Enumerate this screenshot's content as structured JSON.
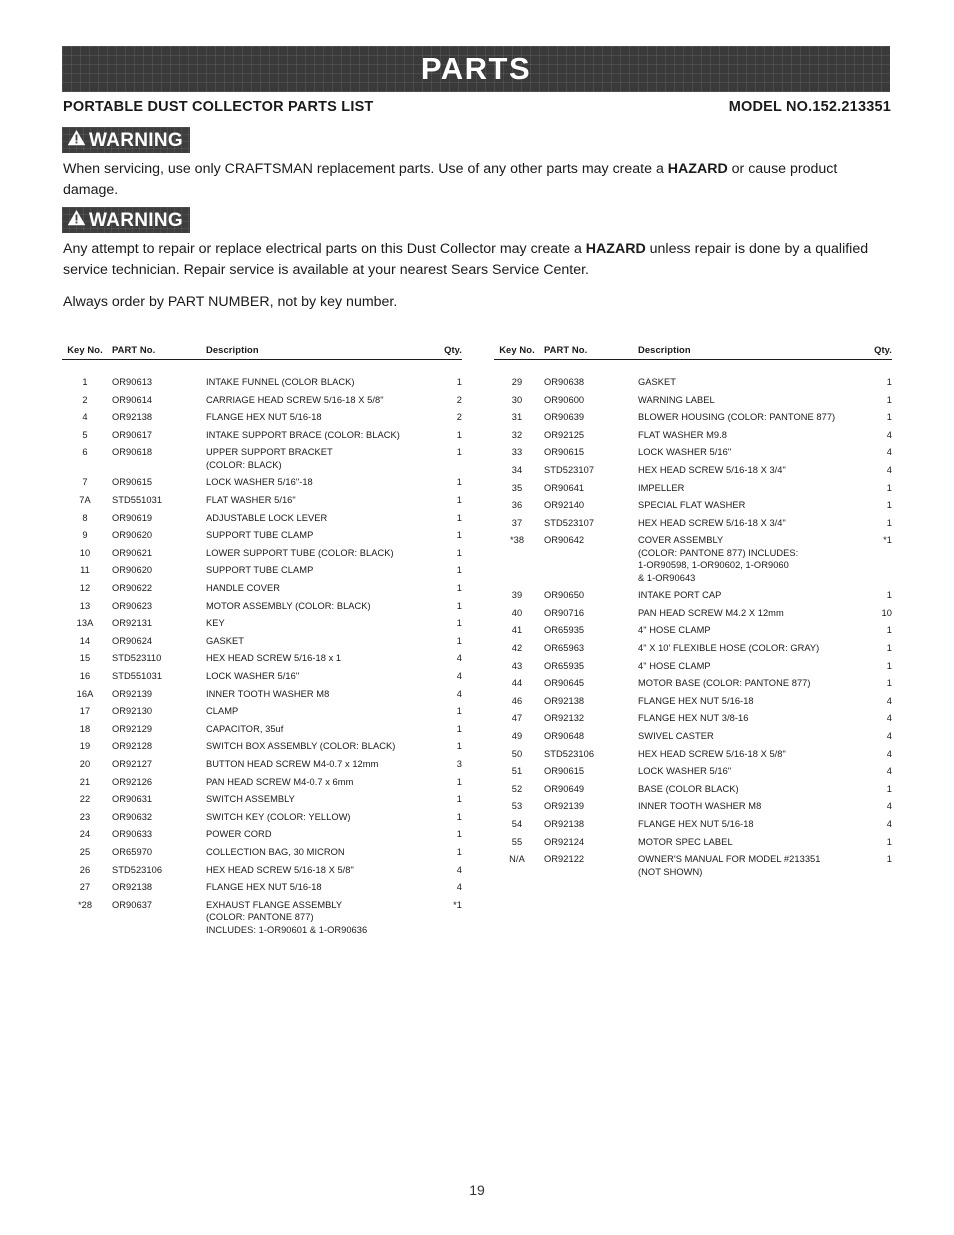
{
  "banner": {
    "title": "PARTS"
  },
  "subheader": {
    "left": "PORTABLE DUST COLLECTOR PARTS LIST",
    "right": "MODEL NO.152.213351"
  },
  "warnings": [
    {
      "badge_label": "WARNING",
      "icon": "warning-triangle-icon",
      "body_before": "When servicing, use only CRAFTSMAN replacement parts. Use of any other parts may create a ",
      "body_bold": "HAZARD",
      "body_after": " or cause product damage."
    },
    {
      "badge_label": "WARNING",
      "icon": "warning-triangle-icon",
      "body_before": "Any attempt to repair or replace electrical parts on this Dust Collector may create a ",
      "body_bold": "HAZARD",
      "body_after": " unless repair is done by a qualified service technician. Repair service is available at your nearest Sears Service Center."
    }
  ],
  "order_note": "Always order by PART NUMBER, not by key number.",
  "table_headers": {
    "key": "Key No.",
    "part": "PART No.",
    "description": "Description",
    "qty": "Qty."
  },
  "left_column_rows": [
    {
      "key": "1",
      "part": "OR90613",
      "desc": [
        "INTAKE FUNNEL (COLOR BLACK)"
      ],
      "qty": "1"
    },
    {
      "key": "2",
      "part": "OR90614",
      "desc": [
        "CARRIAGE HEAD SCREW 5/16-18 X 5/8\""
      ],
      "qty": "2"
    },
    {
      "key": "4",
      "part": "OR92138",
      "desc": [
        "FLANGE HEX NUT 5/16-18"
      ],
      "qty": "2"
    },
    {
      "key": "5",
      "part": "OR90617",
      "desc": [
        "INTAKE SUPPORT BRACE (COLOR: BLACK)"
      ],
      "qty": "1"
    },
    {
      "key": "6",
      "part": "OR90618",
      "desc": [
        "UPPER SUPPORT BRACKET",
        "(COLOR: BLACK)"
      ],
      "qty": "1"
    },
    {
      "key": "7",
      "part": "OR90615",
      "desc": [
        "LOCK WASHER 5/16\"-18"
      ],
      "qty": "1"
    },
    {
      "key": "7A",
      "part": "STD551031",
      "desc": [
        "FLAT WASHER 5/16\""
      ],
      "qty": "1"
    },
    {
      "key": "8",
      "part": "OR90619",
      "desc": [
        "ADJUSTABLE LOCK LEVER"
      ],
      "qty": "1"
    },
    {
      "key": "9",
      "part": "OR90620",
      "desc": [
        "SUPPORT TUBE CLAMP"
      ],
      "qty": "1"
    },
    {
      "key": "10",
      "part": "OR90621",
      "desc": [
        "LOWER SUPPORT TUBE (COLOR: BLACK)"
      ],
      "qty": "1"
    },
    {
      "key": "11",
      "part": "OR90620",
      "desc": [
        "SUPPORT TUBE CLAMP"
      ],
      "qty": "1"
    },
    {
      "key": "12",
      "part": "OR90622",
      "desc": [
        "HANDLE COVER"
      ],
      "qty": "1"
    },
    {
      "key": "13",
      "part": "OR90623",
      "desc": [
        "MOTOR ASSEMBLY (COLOR: BLACK)"
      ],
      "qty": "1"
    },
    {
      "key": "13A",
      "part": "OR92131",
      "desc": [
        "KEY"
      ],
      "qty": "1"
    },
    {
      "key": "14",
      "part": "OR90624",
      "desc": [
        "GASKET"
      ],
      "qty": "1"
    },
    {
      "key": "15",
      "part": "STD523110",
      "desc": [
        "HEX HEAD SCREW 5/16-18 x 1"
      ],
      "qty": "4"
    },
    {
      "key": "16",
      "part": "STD551031",
      "desc": [
        "LOCK WASHER 5/16\""
      ],
      "qty": "4"
    },
    {
      "key": "16A",
      "part": "OR92139",
      "desc": [
        "INNER TOOTH WASHER M8"
      ],
      "qty": "4"
    },
    {
      "key": "17",
      "part": "OR92130",
      "desc": [
        "CLAMP"
      ],
      "qty": "1"
    },
    {
      "key": "18",
      "part": "OR92129",
      "desc": [
        "CAPACITOR, 35uf"
      ],
      "qty": "1"
    },
    {
      "key": "19",
      "part": "OR92128",
      "desc": [
        "SWITCH BOX ASSEMBLY (COLOR: BLACK)"
      ],
      "qty": "1"
    },
    {
      "key": "20",
      "part": "OR92127",
      "desc": [
        "BUTTON HEAD SCREW M4-0.7 x 12mm"
      ],
      "qty": "3"
    },
    {
      "key": "21",
      "part": "OR92126",
      "desc": [
        "PAN HEAD SCREW M4-0.7 x 6mm"
      ],
      "qty": "1"
    },
    {
      "key": "22",
      "part": "OR90631",
      "desc": [
        "SWITCH ASSEMBLY"
      ],
      "qty": "1"
    },
    {
      "key": "23",
      "part": "OR90632",
      "desc": [
        "SWITCH KEY (COLOR: YELLOW)"
      ],
      "qty": "1"
    },
    {
      "key": "24",
      "part": "OR90633",
      "desc": [
        "POWER CORD"
      ],
      "qty": "1"
    },
    {
      "key": "25",
      "part": "OR65970",
      "desc": [
        "COLLECTION BAG, 30 MICRON"
      ],
      "qty": "1"
    },
    {
      "key": "26",
      "part": "STD523106",
      "desc": [
        "HEX HEAD SCREW 5/16-18 X 5/8\""
      ],
      "qty": "4"
    },
    {
      "key": "27",
      "part": "OR92138",
      "desc": [
        "FLANGE HEX NUT 5/16-18"
      ],
      "qty": "4"
    },
    {
      "key": "*28",
      "part": "OR90637",
      "desc": [
        "EXHAUST FLANGE ASSEMBLY",
        "(COLOR: PANTONE 877)",
        "INCLUDES: 1-OR90601 & 1-OR90636"
      ],
      "qty": "*1"
    }
  ],
  "right_column_rows": [
    {
      "key": "29",
      "part": "OR90638",
      "desc": [
        "GASKET"
      ],
      "qty": "1"
    },
    {
      "key": "30",
      "part": "OR90600",
      "desc": [
        "WARNING LABEL"
      ],
      "qty": "1"
    },
    {
      "key": "31",
      "part": "OR90639",
      "desc": [
        "BLOWER HOUSING (COLOR: PANTONE 877)"
      ],
      "qty": "1"
    },
    {
      "key": "32",
      "part": "OR92125",
      "desc": [
        "FLAT WASHER M9.8"
      ],
      "qty": "4"
    },
    {
      "key": "33",
      "part": "OR90615",
      "desc": [
        "LOCK WASHER 5/16\""
      ],
      "qty": "4"
    },
    {
      "key": "34",
      "part": "STD523107",
      "desc": [
        "HEX HEAD SCREW 5/16-18 X 3/4\""
      ],
      "qty": "4"
    },
    {
      "key": "35",
      "part": "OR90641",
      "desc": [
        "IMPELLER"
      ],
      "qty": "1"
    },
    {
      "key": "36",
      "part": "OR92140",
      "desc": [
        "SPECIAL FLAT WASHER"
      ],
      "qty": "1"
    },
    {
      "key": "37",
      "part": "STD523107",
      "desc": [
        "HEX HEAD SCREW 5/16-18 X 3/4\""
      ],
      "qty": "1"
    },
    {
      "key": "*38",
      "part": "OR90642",
      "desc": [
        "COVER ASSEMBLY",
        "(COLOR: PANTONE 877) INCLUDES:",
        "1-OR90598, 1-OR90602, 1-OR9060",
        "& 1-OR90643"
      ],
      "qty": "*1"
    },
    {
      "key": "39",
      "part": "OR90650",
      "desc": [
        "INTAKE PORT CAP"
      ],
      "qty": "1"
    },
    {
      "key": "40",
      "part": "OR90716",
      "desc": [
        "PAN HEAD SCREW M4.2 X 12mm"
      ],
      "qty": "10"
    },
    {
      "key": "41",
      "part": "OR65935",
      "desc": [
        "4\" HOSE CLAMP"
      ],
      "qty": "1"
    },
    {
      "key": "42",
      "part": "OR65963",
      "desc": [
        "4\" X 10' FLEXIBLE HOSE (COLOR: GRAY)"
      ],
      "qty": "1"
    },
    {
      "key": "43",
      "part": "OR65935",
      "desc": [
        "4\" HOSE CLAMP"
      ],
      "qty": "1"
    },
    {
      "key": "44",
      "part": "OR90645",
      "desc": [
        "MOTOR BASE (COLOR: PANTONE 877)"
      ],
      "qty": "1"
    },
    {
      "key": "46",
      "part": "OR92138",
      "desc": [
        "FLANGE HEX NUT 5/16-18"
      ],
      "qty": "4"
    },
    {
      "key": "47",
      "part": "OR92132",
      "desc": [
        "FLANGE HEX NUT 3/8-16"
      ],
      "qty": "4"
    },
    {
      "key": "49",
      "part": "OR90648",
      "desc": [
        "SWIVEL CASTER"
      ],
      "qty": "4"
    },
    {
      "key": "50",
      "part": "STD523106",
      "desc": [
        "HEX HEAD SCREW 5/16-18 X 5/8\""
      ],
      "qty": "4"
    },
    {
      "key": "51",
      "part": "OR90615",
      "desc": [
        "LOCK WASHER 5/16\""
      ],
      "qty": "4"
    },
    {
      "key": "52",
      "part": "OR90649",
      "desc": [
        "BASE (COLOR BLACK)"
      ],
      "qty": "1"
    },
    {
      "key": "53",
      "part": "OR92139",
      "desc": [
        "INNER TOOTH WASHER M8"
      ],
      "qty": "4"
    },
    {
      "key": "54",
      "part": "OR92138",
      "desc": [
        "FLANGE HEX NUT 5/16-18"
      ],
      "qty": "4"
    },
    {
      "key": "55",
      "part": "OR92124",
      "desc": [
        "MOTOR SPEC LABEL"
      ],
      "qty": "1"
    },
    {
      "key": "N/A",
      "part": "OR92122",
      "desc": [
        "OWNER'S MANUAL FOR MODEL #213351",
        "(NOT SHOWN)"
      ],
      "qty": "1"
    }
  ],
  "page_number": "19",
  "colors": {
    "banner_background": "#3a3a3a",
    "banner_text": "#ffffff",
    "badge_background": "#3d3d3d",
    "text": "#1a1a1a"
  }
}
